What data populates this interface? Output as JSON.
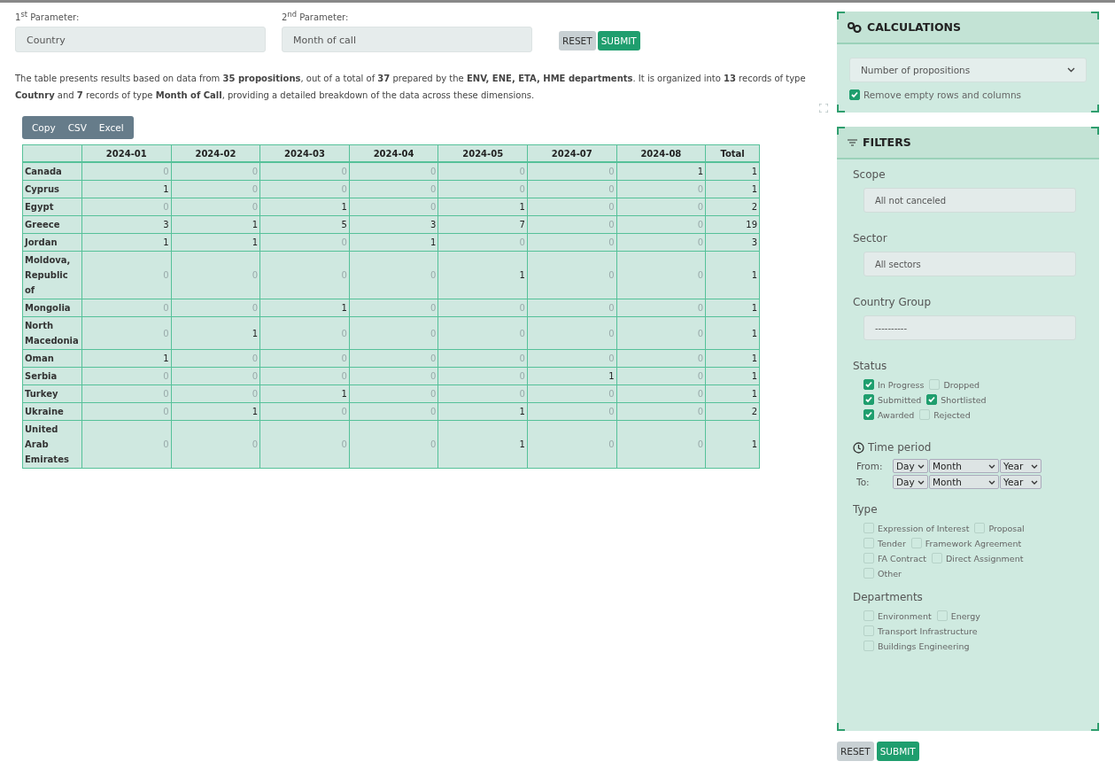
{
  "parameters": [
    {
      "label": "1$^{st}$ Parameter:",
      "value": "Country"
    },
    {
      "label": "2$^{nd}$ Parameter:",
      "value": "Month of call"
    }
  ],
  "top_buttons": [
    {
      "label": "RESET",
      "kind": "reset"
    },
    {
      "label": "SUBMIT",
      "kind": "submit"
    }
  ],
  "summary": "The table presents results based on data from **35 propositions**, out of a total of **37** prepared by the **ENV, ENE, ETA, HME departments**. It is organized into **13** records of type **Coutnry** and **7** records of type **Month of Call**, providing a detailed breakdown of the data across these dimensions.",
  "export_buttons": [
    "Copy",
    "CSV",
    "Excel"
  ],
  "table": {
    "columns": [
      "",
      "2024-01",
      "2024-02",
      "2024-03",
      "2024-04",
      "2024-05",
      "2024-07",
      "2024-08",
      "Total"
    ],
    "rows": [
      {
        "cells": [
          "Canada",
          "0",
          "0",
          "0",
          "0",
          "0",
          "0",
          "1",
          "1"
        ]
      },
      {
        "cells": [
          "Cyprus",
          "1",
          "0",
          "0",
          "0",
          "0",
          "0",
          "0",
          "1"
        ]
      },
      {
        "cells": [
          "Egypt",
          "0",
          "0",
          "1",
          "0",
          "1",
          "0",
          "0",
          "2"
        ]
      },
      {
        "cells": [
          "Greece",
          "3",
          "1",
          "5",
          "3",
          "7",
          "0",
          "0",
          "19"
        ]
      },
      {
        "cells": [
          "Jordan",
          "1",
          "1",
          "0",
          "1",
          "0",
          "0",
          "0",
          "3"
        ]
      },
      {
        "cells": [
          "Moldova, Republic of",
          "0",
          "0",
          "0",
          "0",
          "1",
          "0",
          "0",
          "1"
        ]
      },
      {
        "cells": [
          "Mongolia",
          "0",
          "0",
          "1",
          "0",
          "0",
          "0",
          "0",
          "1"
        ]
      },
      {
        "cells": [
          "North Macedonia",
          "0",
          "1",
          "0",
          "0",
          "0",
          "0",
          "0",
          "1"
        ]
      },
      {
        "cells": [
          "Oman",
          "1",
          "0",
          "0",
          "0",
          "0",
          "0",
          "0",
          "1"
        ]
      },
      {
        "cells": [
          "Serbia",
          "0",
          "0",
          "0",
          "0",
          "0",
          "1",
          "0",
          "1"
        ]
      },
      {
        "cells": [
          "Turkey",
          "0",
          "0",
          "1",
          "0",
          "0",
          "0",
          "0",
          "1"
        ]
      },
      {
        "cells": [
          "Ukraine",
          "0",
          "1",
          "0",
          "0",
          "1",
          "0",
          "0",
          "2"
        ]
      },
      {
        "cells": [
          "United Arab Emirates",
          "0",
          "0",
          "0",
          "0",
          "1",
          "0",
          "0",
          "1"
        ]
      }
    ]
  },
  "calculations": {
    "title": "CALCULATIONS",
    "select": "Number of propositions",
    "checkbox": {
      "label": "Remove empty rows and columns",
      "checked": true
    }
  },
  "filters": {
    "title": "FILTERS",
    "scope": {
      "label": "Scope",
      "value": "All not canceled"
    },
    "sector": {
      "label": "Sector",
      "value": "All sectors"
    },
    "country_group": {
      "label": "Country Group",
      "value": "----------"
    },
    "status": {
      "label": "Status",
      "rows": [
        [
          {
            "label": "In Progress",
            "checked": true
          },
          {
            "label": "Dropped",
            "checked": false
          }
        ],
        [
          {
            "label": "Submitted",
            "checked": true
          },
          {
            "label": "Shortlisted",
            "checked": true
          }
        ],
        [
          {
            "label": "Awarded",
            "checked": true
          },
          {
            "label": "Rejected",
            "checked": false
          }
        ]
      ]
    },
    "time_period": {
      "label": "Time period",
      "rows": [
        {
          "label": "From:",
          "selects": [
            "Day",
            "Month",
            "Year"
          ]
        },
        {
          "label": "To:",
          "selects": [
            "Day",
            "Month",
            "Year"
          ]
        }
      ]
    },
    "type": {
      "label": "Type",
      "rows": [
        [
          {
            "label": "Expression of Interest",
            "checked": false
          },
          {
            "label": "Proposal",
            "checked": false
          }
        ],
        [
          {
            "label": "Tender",
            "checked": false
          },
          {
            "label": "Framework Agreement",
            "checked": false
          }
        ],
        [
          {
            "label": "FA Contract",
            "checked": false
          },
          {
            "label": "Direct Assignment",
            "checked": false
          }
        ],
        [
          {
            "label": "Other",
            "checked": false
          }
        ]
      ]
    },
    "departments": {
      "label": "Departments",
      "rows": [
        [
          {
            "label": "Environment",
            "checked": false
          },
          {
            "label": "Energy",
            "checked": false
          }
        ],
        [
          {
            "label": "Transport Infrastructure",
            "checked": false
          }
        ],
        [
          {
            "label": "Buildings Engineering",
            "checked": false
          }
        ]
      ]
    }
  },
  "bottom_buttons": [
    {
      "label": "RESET",
      "kind": "reset"
    },
    {
      "label": "SUBMIT",
      "kind": "submit"
    }
  ]
}
